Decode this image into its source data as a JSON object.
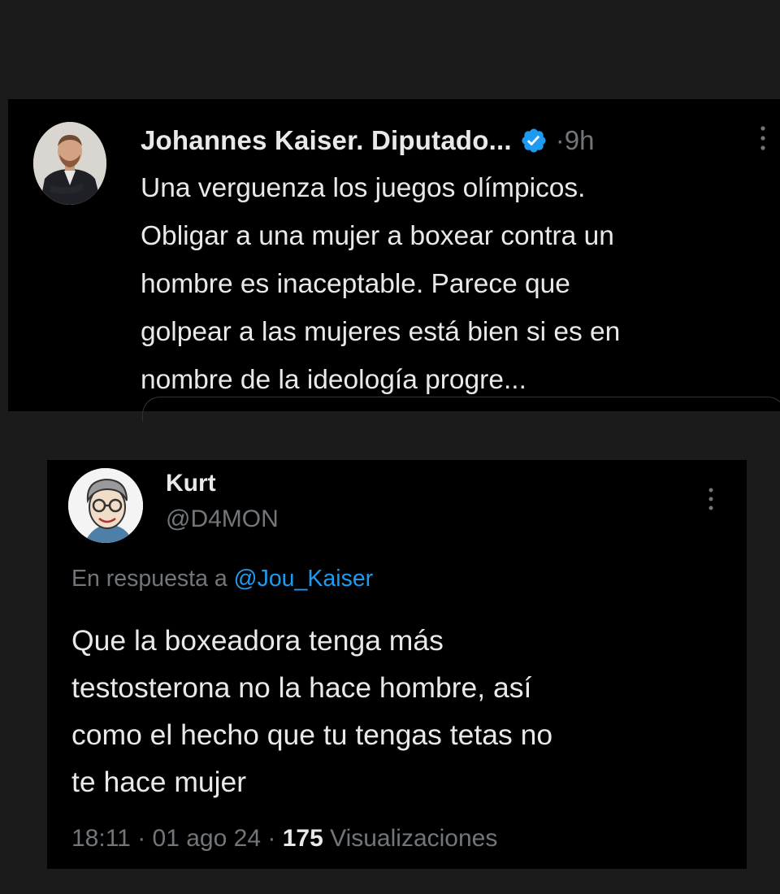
{
  "tweet1": {
    "author_name": "Johannes Kaiser. Diputado...",
    "separator": "·",
    "time": "9h",
    "text_lines": [
      "Una verguenza los juegos olímpicos.",
      "Obligar a una mujer a boxear contra un",
      "hombre es inaceptable. Parece que",
      "golpear a las mujeres está bien si es en",
      "nombre de la ideología progre..."
    ],
    "icons": {
      "verified": "verified-badge-icon",
      "more": "more-options-icon"
    }
  },
  "tweet2": {
    "author_name": "Kurt",
    "handle": "@D4MON",
    "reply_prefix": "En respuesta a ",
    "reply_mention": "@Jou_Kaiser",
    "text_lines": [
      "Que la boxeadora tenga más",
      "testosterona no la hace hombre, así",
      "como el hecho que tu tengas tetas no",
      "te hace mujer"
    ],
    "time": "18:11",
    "date": "01 ago 24",
    "views_count": "175",
    "views_label": "Visualizaciones",
    "separator": "·",
    "icons": {
      "more": "more-options-icon"
    }
  },
  "colors": {
    "background": "#000000",
    "outer": "#1b1b1b",
    "text": "#e7e9ea",
    "muted": "#71767b",
    "link": "#1d9bf0",
    "verified": "#1d9bf0"
  }
}
